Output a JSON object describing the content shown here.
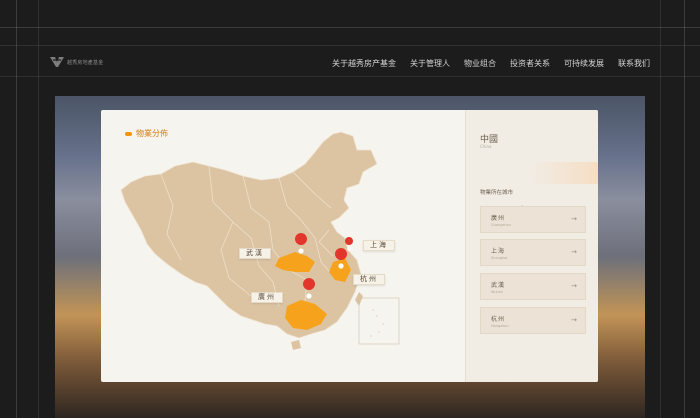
{
  "header": {
    "logo_text": "越秀房地產基金",
    "nav": [
      "关于越秀房产基金",
      "关于管理人",
      "物业组合",
      "投资者关系",
      "可持续发展",
      "联系我们"
    ]
  },
  "card": {
    "title": "物業分佈",
    "map_labels": {
      "wuhan": "武漢",
      "shanghai": "上海",
      "hangzhou": "杭州",
      "guangzhou": "廣州"
    }
  },
  "side": {
    "country": "中國",
    "country_en": "China",
    "subtitle": "物業所在城市",
    "cities": [
      {
        "name": "廣州",
        "en": "Guangzhou"
      },
      {
        "name": "上海",
        "en": "Shanghai"
      },
      {
        "name": "武漢",
        "en": "Wuhan"
      },
      {
        "name": "杭州",
        "en": "Hangzhou"
      }
    ]
  },
  "colors": {
    "accent": "#f39513",
    "map_land": "#dcc4a3",
    "highlight": "#f7a21c",
    "pin": "#e2352b"
  },
  "icons": [
    "logo-icon",
    "arrow-right-icon",
    "map-pin-icon",
    "cursor-icon"
  ]
}
